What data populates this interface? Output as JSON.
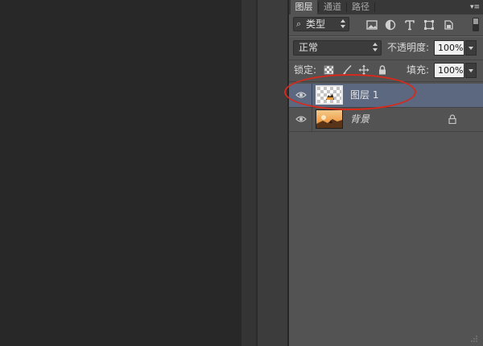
{
  "tabs": [
    {
      "label": "图层",
      "active": true
    },
    {
      "label": "通道",
      "active": false
    },
    {
      "label": "路径",
      "active": false
    }
  ],
  "panel_menu_icon": "panel-menu-icon",
  "filter": {
    "search_icon": "search-icon",
    "kind_label": "类型",
    "filter_icons": [
      "image-filter-icon",
      "adjustment-filter-icon",
      "type-filter-icon",
      "shape-filter-icon",
      "smart-object-filter-icon"
    ]
  },
  "blend": {
    "mode": "正常",
    "opacity_label": "不透明度:",
    "opacity_value": "100%"
  },
  "lock": {
    "label": "锁定:",
    "icons": [
      "lock-transparent-icon",
      "lock-image-icon",
      "lock-position-icon",
      "lock-all-icon"
    ],
    "fill_label": "填充:",
    "fill_value": "100%"
  },
  "layers": [
    {
      "name": "图层 1",
      "selected": true,
      "visible": true,
      "locked": false
    },
    {
      "name": "背景",
      "selected": false,
      "visible": true,
      "locked": true
    }
  ],
  "colors": {
    "selection_highlight": "#5b6880",
    "annotation_ellipse": "#d62a1d"
  }
}
